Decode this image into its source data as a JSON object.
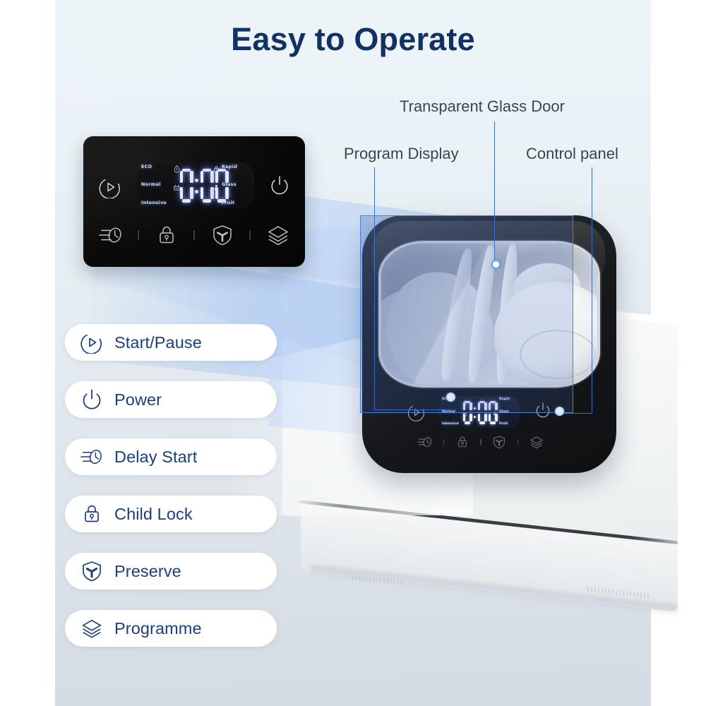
{
  "page": {
    "title": "Easy to Operate",
    "title_color": "#123263",
    "background_color": "#e4ecf1",
    "accent_color": "#3f6fc4"
  },
  "annotations": [
    {
      "id": "glass-door",
      "label": "Transparent Glass Door"
    },
    {
      "id": "program-display",
      "label": "Program Display"
    },
    {
      "id": "control-panel",
      "label": "Control panel"
    }
  ],
  "control_panel": {
    "display": {
      "value": "0:00",
      "digits": [
        "0",
        "0",
        "0"
      ],
      "left_modes": [
        "ECO",
        "Normal",
        "Intensive"
      ],
      "right_modes": [
        "Rapid",
        "Glass",
        "Fruit"
      ],
      "left_icons": [
        "water-drop-icon",
        "wash-basket-icon"
      ],
      "right_icons": [
        "lock-icon",
        "dispenser-icon"
      ],
      "glow_color": "#e9ecff"
    },
    "buttons": [
      {
        "id": "start-pause",
        "icon": "play-circle-icon"
      },
      {
        "id": "power",
        "icon": "power-icon"
      }
    ],
    "touch_row": [
      {
        "id": "delay-start",
        "icon": "delay-start-icon"
      },
      {
        "id": "child-lock",
        "icon": "lock-icon"
      },
      {
        "id": "preserve",
        "icon": "shield-fan-icon"
      },
      {
        "id": "programme",
        "icon": "layers-icon"
      }
    ]
  },
  "legend": {
    "items": [
      {
        "label": "Start/Pause",
        "icon": "play-circle-icon"
      },
      {
        "label": "Power",
        "icon": "power-icon"
      },
      {
        "label": "Delay Start",
        "icon": "delay-start-icon"
      },
      {
        "label": "Child Lock",
        "icon": "lock-icon"
      },
      {
        "label": "Preserve",
        "icon": "shield-fan-icon"
      },
      {
        "label": "Programme",
        "icon": "layers-icon"
      }
    ]
  },
  "product": {
    "name": "countertop-dishwasher",
    "display_value": "0:00"
  }
}
